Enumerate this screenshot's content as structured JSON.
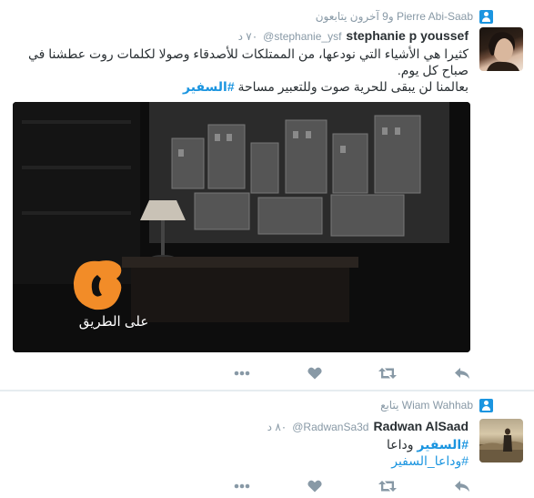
{
  "tweet1": {
    "context": "Pierre Abi-Saab و9 آخرون يتابعون",
    "name": "stephanie p youssef",
    "handle": "@stephanie_ysf",
    "time": "٧٠ د",
    "line1": "كثيرا هي الأشياء التي نودعها، من الممتلكات للأصدقاء وصولا لكلمات روت عطشنا في",
    "line2": "صباح كل يوم.",
    "line3_text": "بعالمنا لن يبقى للحرية صوت وللتعبير مساحة",
    "hashtag": "#السفير",
    "media_caption": "على الطريق"
  },
  "tweet2": {
    "context": "Wiam Wahhab يتابع",
    "name": "Radwan AlSaad",
    "handle": "@RadwanSa3d",
    "time": "٨٠ د",
    "hashtag": "#السفير",
    "word": "وداعا",
    "hashtag2": "#وداعا_السفير"
  },
  "icons": {
    "context": "person-icon",
    "more": "more-icon",
    "like": "heart-icon",
    "retweet": "retweet-icon",
    "reply": "reply-icon"
  },
  "colors": {
    "accent": "#1b95e0",
    "muted": "#8899a6",
    "logo": "#f28c28"
  }
}
